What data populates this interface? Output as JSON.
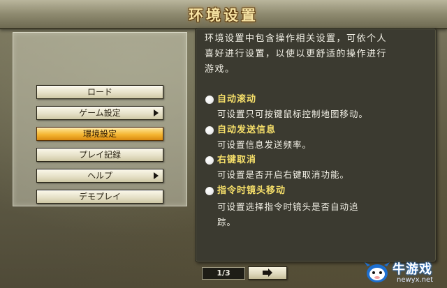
{
  "title": "环境设置",
  "menu": {
    "items": [
      {
        "label": "ロード",
        "has_arrow": false,
        "active": false
      },
      {
        "label": "ゲーム設定",
        "has_arrow": true,
        "active": false
      },
      {
        "label": "環境設定",
        "has_arrow": false,
        "active": true
      },
      {
        "label": "プレイ記録",
        "has_arrow": false,
        "active": false
      },
      {
        "label": "ヘルプ",
        "has_arrow": true,
        "active": false
      },
      {
        "label": "デモプレイ",
        "has_arrow": false,
        "active": false
      }
    ]
  },
  "description": {
    "intro": "环境设置中包含操作相关设置，可依个人\n喜好进行设置，以使以更舒适的操作进行\n游戏。",
    "options": [
      {
        "title": "自动滚动",
        "desc": "可设置只可按键鼠标控制地图移动。"
      },
      {
        "title": "自动发送信息",
        "desc": "可设置信息发送频率。"
      },
      {
        "title": "右键取消",
        "desc": "可设置是否开启右键取消功能。"
      },
      {
        "title": "指令时镜头移动",
        "desc": "可设置选择指令时镜头是否自动追\n踪。"
      }
    ]
  },
  "pagination": {
    "page_label": "1/3",
    "next_icon": "right-arrow-icon"
  },
  "watermark": {
    "text": "牛游戏",
    "url": "newyx.net"
  },
  "colors": {
    "accent_title": "#f7e3a3",
    "option_title": "#f7e06a",
    "active_button": "#f5b632",
    "panel_bg": "#3b3a30"
  }
}
